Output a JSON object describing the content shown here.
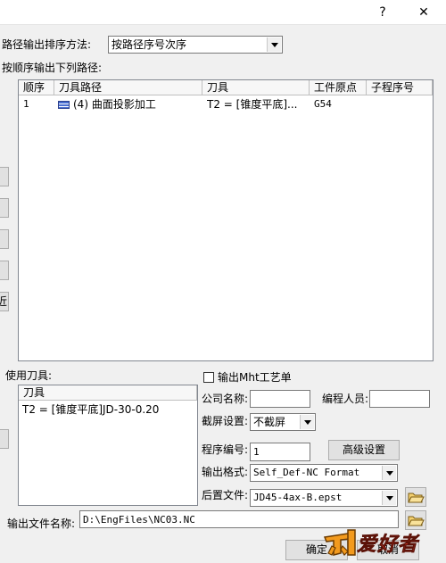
{
  "window": {
    "help_glyph": "?",
    "close_glyph": "✕"
  },
  "sort": {
    "label": "路径输出排序方法:",
    "selected": "按路径序号次序"
  },
  "paths": {
    "label": "按顺序输出下列路径:",
    "columns": [
      "顺序",
      "刀具路径",
      "刀具",
      "工件原点",
      "子程序号"
    ],
    "rows": [
      {
        "order": "1",
        "path": "(4) 曲面投影加工",
        "tool": "T2 = [锥度平底]...",
        "origin": "G54",
        "sub": ""
      }
    ]
  },
  "side_buttons": {
    "last_visible_text": "近"
  },
  "tools": {
    "label": "使用刀具:",
    "column": "刀具",
    "rows": [
      "T2 = [锥度平底]JD-30-0.20"
    ]
  },
  "options": {
    "mht_label": "输出Mht工艺单",
    "mht_checked": false,
    "company_label": "公司名称:",
    "company_value": "",
    "programmer_label": "编程人员:",
    "programmer_value": "",
    "screenshot_label": "截屏设置:",
    "screenshot_value": "不截屏",
    "program_no_label": "程序编号:",
    "program_no_value": "1",
    "advanced_button": "高级设置",
    "format_label": "输出格式:",
    "format_value": "Self_Def-NC Format",
    "post_label": "后置文件:",
    "post_value": "JD45-4ax-B.epst"
  },
  "output": {
    "label": "输出文件名称:",
    "value": "D:\\EngFiles\\NC03.NC"
  },
  "footer": {
    "ok": "确定",
    "cancel": "取消"
  },
  "watermark": {
    "text": "爱好者"
  },
  "colors": {
    "watermark_orange": "#f29a1e",
    "watermark_red": "#d8362b"
  }
}
